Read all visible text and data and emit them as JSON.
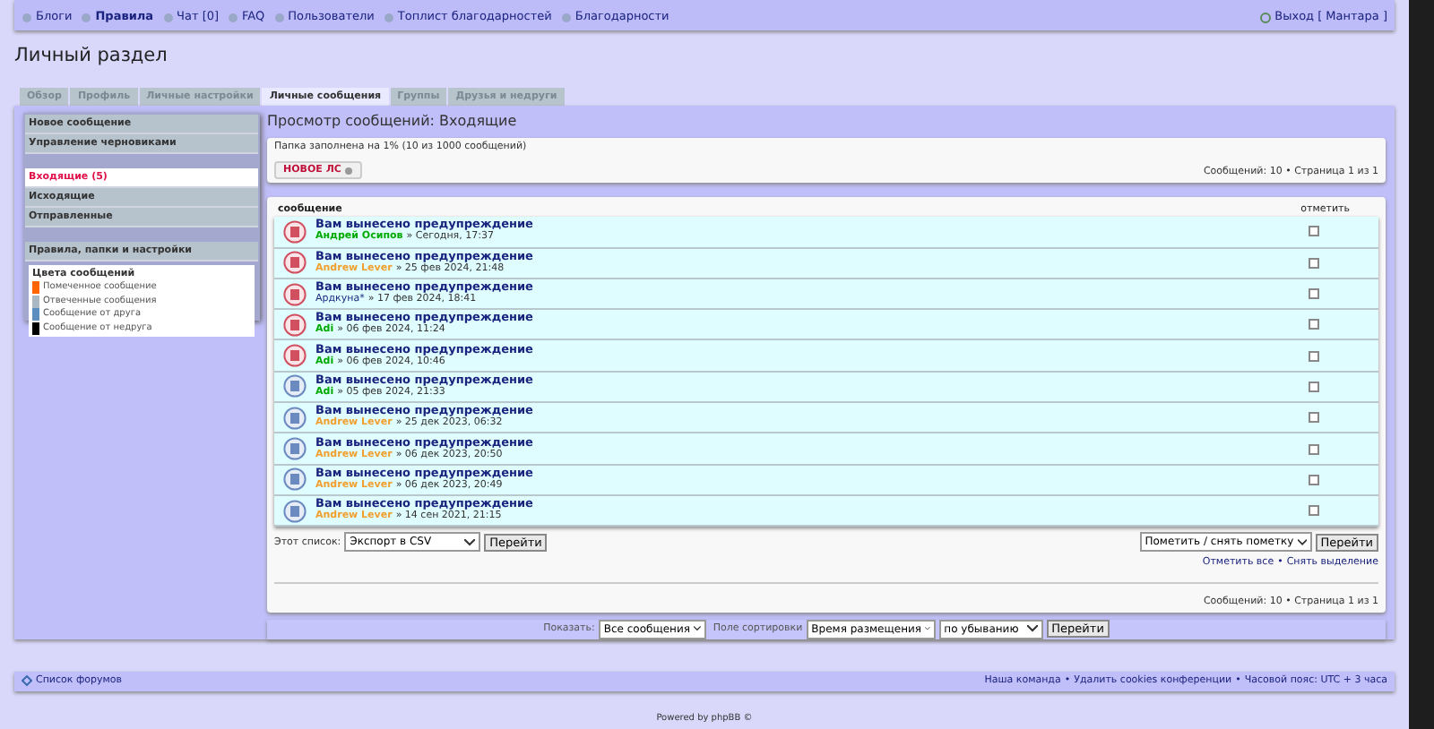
{
  "nav_links": [
    {
      "label": "Блоги",
      "bold": false
    },
    {
      "label": "Правила",
      "bold": true
    },
    {
      "label": "Чат [0]",
      "bold": false
    },
    {
      "label": "FAQ",
      "bold": false
    },
    {
      "label": "Пользователи",
      "bold": false
    },
    {
      "label": "Топлист благодарностей",
      "bold": false
    },
    {
      "label": "Благодарности",
      "bold": false
    }
  ],
  "logout": {
    "label": "Выход",
    "user": "[ Мантара ]"
  },
  "page_title": "Личный раздел",
  "tabs": [
    {
      "label": "Обзор",
      "selected": false
    },
    {
      "label": "Профиль",
      "selected": false
    },
    {
      "label": "Личные настройки",
      "selected": false
    },
    {
      "label": "Личные сообщения",
      "selected": true
    },
    {
      "label": "Группы",
      "selected": false
    },
    {
      "label": "Друзья и недруги",
      "selected": false
    }
  ],
  "sidebar": {
    "groups": [
      [
        {
          "label": "Новое сообщение",
          "selected": false
        },
        {
          "label": "Управление черновиками",
          "selected": false
        }
      ],
      [
        {
          "label": "Входящие (5)",
          "selected": true
        },
        {
          "label": "Исходящие",
          "selected": false
        },
        {
          "label": "Отправленные",
          "selected": false
        }
      ],
      [
        {
          "label": "Правила, папки и настройки",
          "selected": false
        }
      ]
    ],
    "legend_title": "Цвета сообщений",
    "legend": [
      {
        "label": "Помеченное сообщение",
        "color": "#ff6600"
      },
      {
        "label": "Отвеченные сообщения",
        "color": "#a9b8c2"
      },
      {
        "label": "Сообщение от друга",
        "color": "#5c8fc0"
      },
      {
        "label": "Сообщение от недруга",
        "color": "#000000"
      }
    ]
  },
  "content_title": "Просмотр сообщений: Входящие",
  "folder_usage": "Папка заполнена на 1% (10 из 1000 сообщений)",
  "new_pm_button": "НОВОЕ ЛС",
  "pagination": "Сообщений: 10 • Страница 1 из 1",
  "columns": [
    "сообщение",
    "отметить"
  ],
  "messages": [
    {
      "subject": "Вам вынесено предупреждение",
      "author": "Андрей Осипов",
      "color": "#00aa00",
      "author_bold": true,
      "date": "» Сегодня, 17:37",
      "unread": true,
      "checked": false
    },
    {
      "subject": "Вам вынесено предупреждение",
      "author": "Andrew Lever",
      "color": "#f0a030",
      "author_bold": true,
      "date": "» 25 фев 2024, 21:48",
      "unread": true,
      "checked": false
    },
    {
      "subject": "Вам вынесено предупреждение",
      "author": "Ардкуна*",
      "color": "#1c2a80",
      "author_bold": false,
      "date": "» 17 фев 2024, 18:41",
      "unread": true,
      "checked": false
    },
    {
      "subject": "Вам вынесено предупреждение",
      "author": "Adi",
      "color": "#00aa00",
      "author_bold": true,
      "date": "» 06 фев 2024, 11:24",
      "unread": true,
      "checked": false
    },
    {
      "subject": "Вам вынесено предупреждение",
      "author": "Adi",
      "color": "#00aa00",
      "author_bold": true,
      "date": "» 06 фев 2024, 10:46",
      "unread": true,
      "checked": false
    },
    {
      "subject": "Вам вынесено предупреждение",
      "author": "Adi",
      "color": "#00aa00",
      "author_bold": true,
      "date": "» 05 фев 2024, 21:33",
      "unread": false,
      "checked": false
    },
    {
      "subject": "Вам вынесено предупреждение",
      "author": "Andrew Lever",
      "color": "#f0a030",
      "author_bold": true,
      "date": "» 25 дек 2023, 06:32",
      "unread": false,
      "checked": false
    },
    {
      "subject": "Вам вынесено предупреждение",
      "author": "Andrew Lever",
      "color": "#f0a030",
      "author_bold": true,
      "date": "» 06 дек 2023, 20:50",
      "unread": false,
      "checked": false
    },
    {
      "subject": "Вам вынесено предупреждение",
      "author": "Andrew Lever",
      "color": "#f0a030",
      "author_bold": true,
      "date": "» 06 дек 2023, 20:49",
      "unread": false,
      "checked": false
    },
    {
      "subject": "Вам вынесено предупреждение",
      "author": "Andrew Lever",
      "color": "#f0a030",
      "author_bold": true,
      "date": "» 14 сен 2021, 21:15",
      "unread": false,
      "checked": false
    }
  ],
  "list_action": {
    "label": "Этот список:",
    "value": "Экспорт в CSV",
    "button": "Перейти"
  },
  "mark_action": {
    "value": "Пометить / снять пометку",
    "button": "Перейти"
  },
  "mark_links": [
    "Отметить все",
    "Снять выделение"
  ],
  "mark_links_separator": "•",
  "pagination_bottom": "Сообщений: 10 • Страница 1 из 1",
  "sort_bar": {
    "show_label": "Показать:",
    "show_value": "Все сообщения",
    "sort_label": "Поле сортировки",
    "sort_value": "Время размещения",
    "order_value": "по убыванию",
    "button": "Перейти"
  },
  "footer": {
    "forum_list": "Список форумов",
    "links": [
      "Наша команда",
      "Удалить cookies конференции"
    ],
    "separator": "•",
    "timezone": "Часовой пояс: UTC + 3 часа"
  },
  "powered": "Powered by phpBB ©"
}
